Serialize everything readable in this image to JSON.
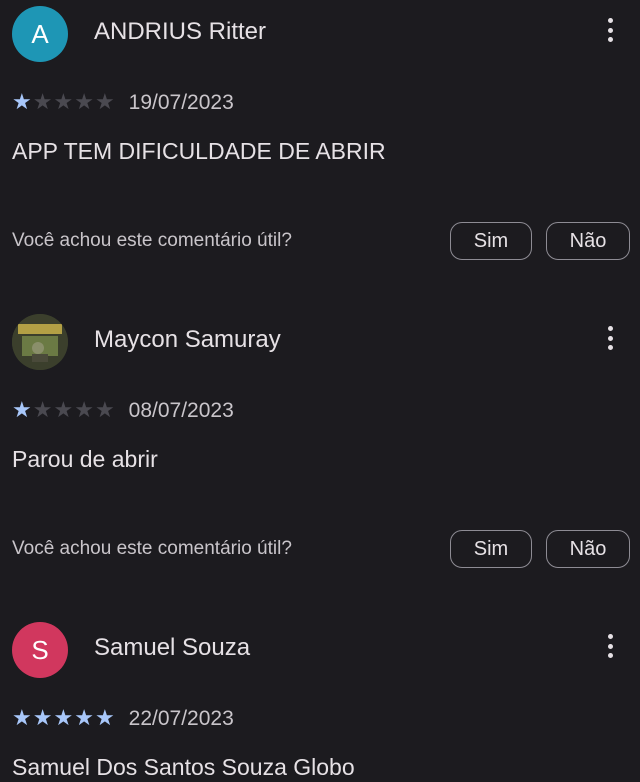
{
  "reviews": [
    {
      "avatar_letter": "A",
      "author": "ANDRIUS Ritter",
      "rating": 1,
      "max_rating": 5,
      "date": "19/07/2023",
      "text": "APP TEM DIFICULDADE DE ABRIR",
      "helpful_question": "Você achou este comentário útil?",
      "yes_label": "Sim",
      "no_label": "Não"
    },
    {
      "avatar_letter": "",
      "author": "Maycon Samuray",
      "rating": 1,
      "max_rating": 5,
      "date": "08/07/2023",
      "text": "Parou de abrir",
      "helpful_question": "Você achou este comentário útil?",
      "yes_label": "Sim",
      "no_label": "Não"
    },
    {
      "avatar_letter": "S",
      "author": "Samuel Souza",
      "rating": 5,
      "max_rating": 5,
      "date": "22/07/2023",
      "text": "Samuel Dos Santos Souza Globo"
    }
  ],
  "colors": {
    "background": "#1c1b1f",
    "star_filled": "#a8c7fa",
    "star_empty": "#4a4950",
    "avatar_teal": "#1e96b5",
    "avatar_red": "#d1375e"
  }
}
